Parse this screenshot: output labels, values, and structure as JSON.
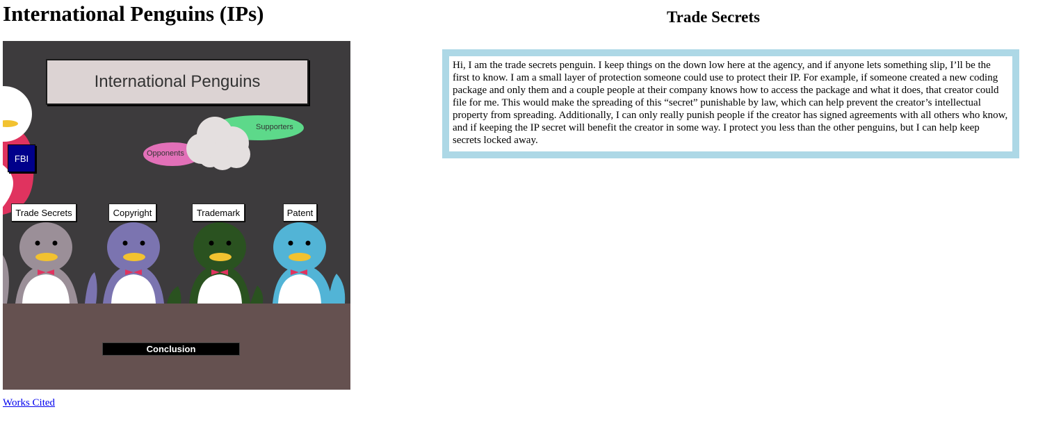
{
  "page": {
    "title": "International Penguins (IPs)",
    "works_cited_label": "Works Cited"
  },
  "scene": {
    "sign_text": "International Penguins",
    "supporters_label": "Supporters",
    "opponents_label": "Opponents",
    "fbi_label": "FBI",
    "conclusion_label": "Conclusion",
    "penguin_tags": [
      "Trade Secrets",
      "Copyright",
      "Trademark",
      "Patent"
    ],
    "colors": {
      "background": "#3d3b3d",
      "floor": "#655150",
      "trade_secrets_penguin": "#9b8f98",
      "copyright_penguin": "#7b74b0",
      "trademark_penguin": "#2a5220",
      "patent_penguin": "#52b4d6",
      "supporters_oval": "#5dd98a",
      "opponents_oval": "#e270b8",
      "fbi_button": "#00008b"
    }
  },
  "panel": {
    "heading": "Trade Secrets",
    "body": "Hi, I am the trade secrets penguin. I keep things on the down low here at the agency, and if anyone lets something slip, I’ll be the first to know. I am a small layer of protection someone could use to protect their IP. For example, if someone created a new coding package and only them and a couple people at their company knows how to access the package and what it does, that creator could file for me. This would make the spreading of this “secret” punishable by law, which can help prevent the creator’s intellectual property from spreading. Additionally, I can only really punish people if the creator has signed agreements with all others who know, and if keeping the IP secret will benefit the creator in some way. I protect you less than the other penguins, but I can help keep secrets locked away.",
    "border_color": "#add8e6"
  }
}
